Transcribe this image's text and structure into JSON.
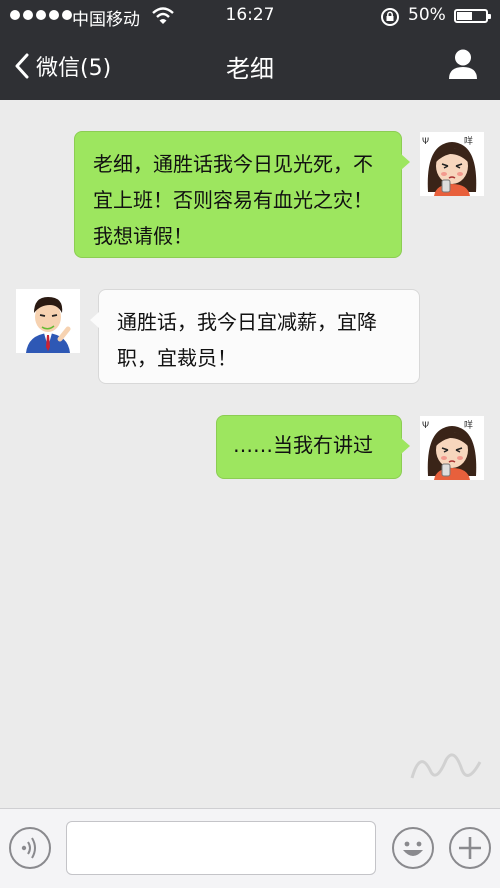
{
  "status_bar": {
    "carrier": "中国移动",
    "time": "16:27",
    "battery": "50%",
    "battery_level": 0.5
  },
  "nav": {
    "back_label": "微信(5)",
    "title": "老细"
  },
  "messages": [
    {
      "sender": "me",
      "text": "老细，通胜话我今日见光死，不宜上班！否则容易有血光之灾！我想请假！"
    },
    {
      "sender": "them",
      "text": "通胜话，我今日宜减薪，宜降职，宜裁员！"
    },
    {
      "sender": "me",
      "text": "……当我冇讲过"
    }
  ],
  "input_bar": {
    "placeholder": ""
  },
  "icons": {
    "voice": "voice-icon",
    "emoji": "emoji-icon",
    "plus": "plus-icon",
    "contact": "person-icon",
    "back": "chevron-left-icon"
  },
  "colors": {
    "nav_bg": "#2f3034",
    "chat_bg": "#ebebeb",
    "my_bubble": "#9de65f",
    "their_bubble": "#fbfbfb"
  }
}
